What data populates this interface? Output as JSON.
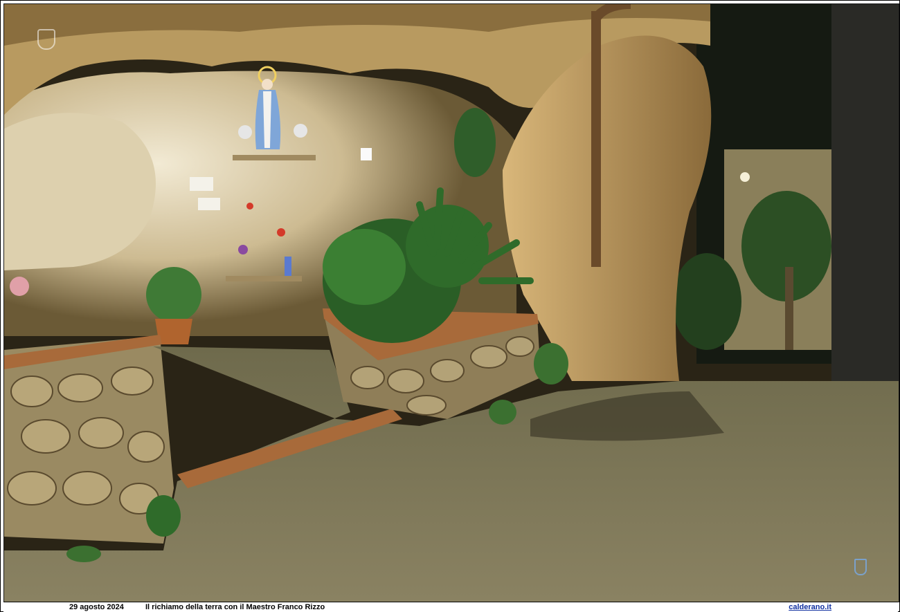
{
  "photo": {
    "subject": "grotto-shrine-night-scene",
    "icons": {
      "watermark_top_left": "crest-icon",
      "watermark_bottom_right": "coat-of-arms-icon"
    },
    "colors": {
      "rock_light": "#e8dcc0",
      "rock_warm": "#c9a568",
      "rock_shadow": "#5a4a2a",
      "floor": "#7a7256",
      "floor_dark": "#4a4632",
      "foliage": "#2f6b2a",
      "foliage_light": "#4f9a3e",
      "statue_robe": "#7fa6d8",
      "brick": "#a86a3a",
      "night": "#141a12"
    }
  },
  "caption": {
    "date": "29 agosto 2024",
    "title": "Il richiamo della terra con il Maestro Franco Rizzo",
    "site": "calderano.it"
  }
}
